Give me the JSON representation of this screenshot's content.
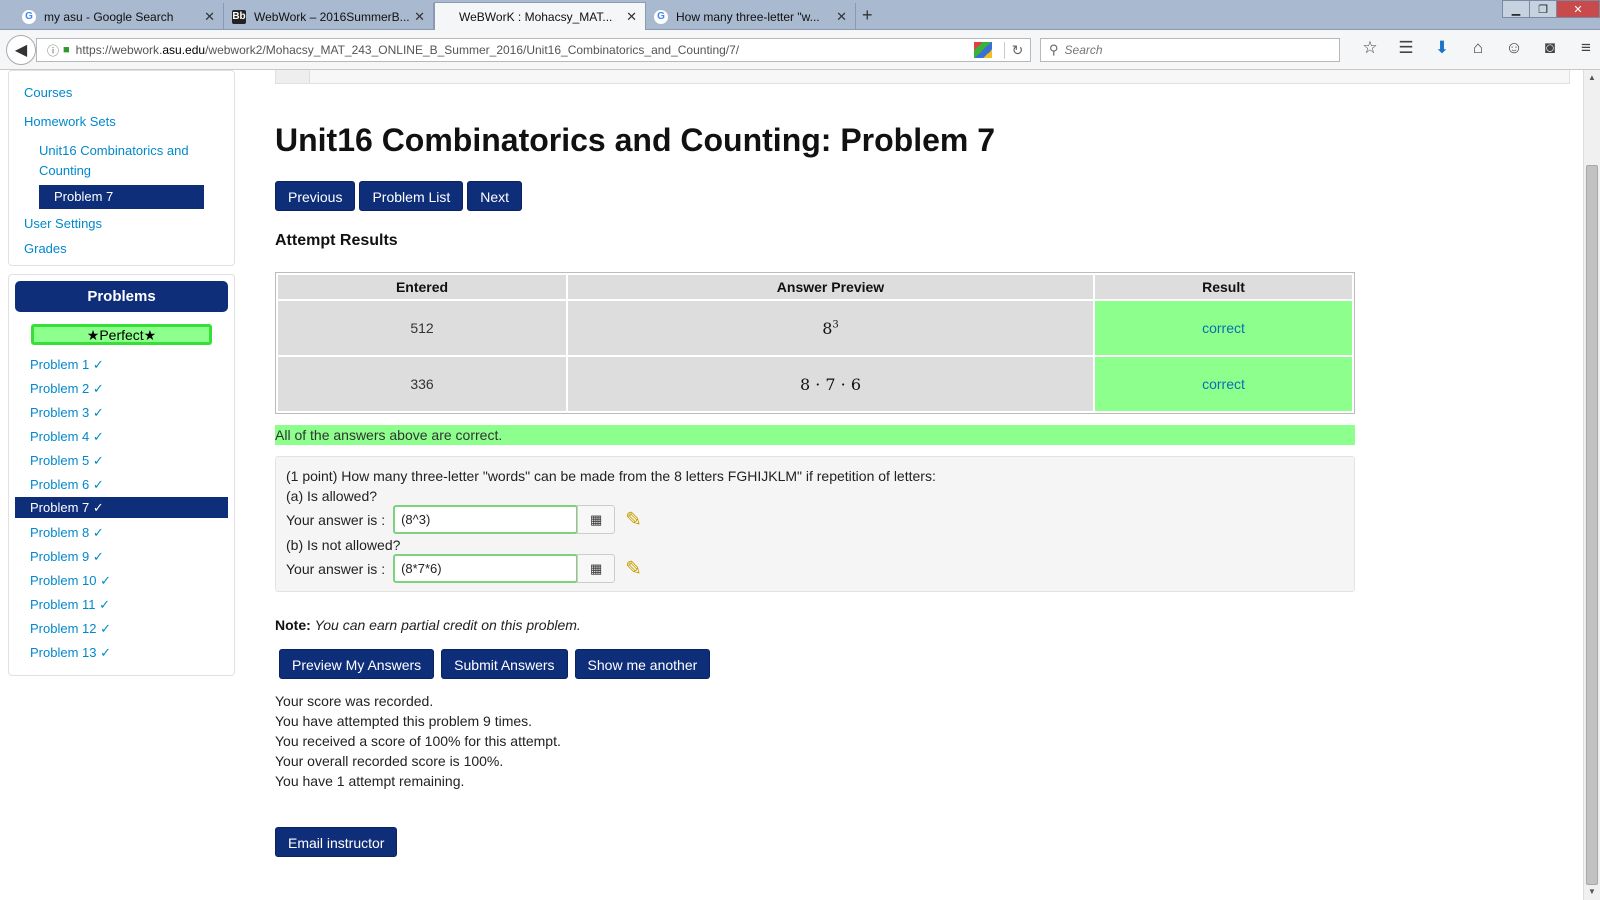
{
  "browser": {
    "tabs": [
      {
        "title": "my asu - Google Search",
        "favicon": "G",
        "favicon_color": "#4285f4",
        "active": false
      },
      {
        "title": "WebWork – 2016SummerB...",
        "favicon": "Bb",
        "favicon_color": "#222222",
        "active": false
      },
      {
        "title": "WeBWorK : Mohacsy_MAT...",
        "favicon": "",
        "favicon_color": "#ffffff",
        "active": true
      },
      {
        "title": "How many three-letter \"w...",
        "favicon": "G",
        "favicon_color": "#4285f4",
        "active": false
      }
    ],
    "new_tab": "+",
    "url_prefix": "https://webwork.",
    "url_host": "asu.edu",
    "url_path": "/webwork2/Mohacsy_MAT_243_ONLINE_B_Summer_2016/Unit16_Combinatorics_and_Counting/7/",
    "search_placeholder": "Search"
  },
  "sidebar": {
    "links": [
      {
        "label": "Courses"
      },
      {
        "label": "Homework Sets"
      },
      {
        "label": "Unit16 Combinatorics and Counting"
      },
      {
        "label": "Problem 7"
      },
      {
        "label": "User Settings"
      },
      {
        "label": "Grades"
      }
    ],
    "problems_header": "Problems",
    "perfect_badge": "★Perfect★",
    "problems": [
      {
        "label": "Problem 1 ✓"
      },
      {
        "label": "Problem 2 ✓"
      },
      {
        "label": "Problem 3 ✓"
      },
      {
        "label": "Problem 4 ✓"
      },
      {
        "label": "Problem 5 ✓"
      },
      {
        "label": "Problem 6 ✓"
      },
      {
        "label": "Problem 7 ✓"
      },
      {
        "label": "Problem 8 ✓"
      },
      {
        "label": "Problem 9 ✓"
      },
      {
        "label": "Problem 10 ✓"
      },
      {
        "label": "Problem 11 ✓"
      },
      {
        "label": "Problem 12 ✓"
      },
      {
        "label": "Problem 13 ✓"
      }
    ]
  },
  "main": {
    "title": "Unit16 Combinatorics and Counting: Problem 7",
    "nav_buttons": {
      "previous": "Previous",
      "problem_list": "Problem List",
      "next": "Next"
    },
    "attempt_results_heading": "Attempt Results",
    "results_table": {
      "headers": [
        "Entered",
        "Answer Preview",
        "Result"
      ],
      "rows": [
        {
          "entered": "512",
          "preview_base": "8",
          "preview_exp": "3",
          "result": "correct"
        },
        {
          "entered": "336",
          "preview_base": "8 · 7 · 6",
          "preview_exp": "",
          "result": "correct"
        }
      ]
    },
    "all_correct_message": "All of the answers above are correct.",
    "problem": {
      "statement": "(1 point) How many three-letter \"words\" can be made from the 8 letters FGHIJKLM\" if repetition of letters:",
      "part_a": "(a) Is allowed?",
      "part_b": "(b) Is not allowed?",
      "answer_label": "Your answer is :",
      "answer_a": "(8^3)",
      "answer_b": "(8*7*6)"
    },
    "note_label": "Note:",
    "note_text": "You can earn partial credit on this problem.",
    "action_buttons": {
      "preview": "Preview My Answers",
      "submit": "Submit Answers",
      "another": "Show me another"
    },
    "score_lines": [
      "Your score was recorded.",
      "You have attempted this problem 9 times.",
      "You received a score of 100% for this attempt.",
      "Your overall recorded score is 100%.",
      "You have 1 attempt remaining."
    ],
    "email_button": "Email instructor"
  },
  "colors": {
    "nav_blue": "#0e2e7a",
    "correct_green": "#8cff8c",
    "link_blue": "#0088cc"
  }
}
